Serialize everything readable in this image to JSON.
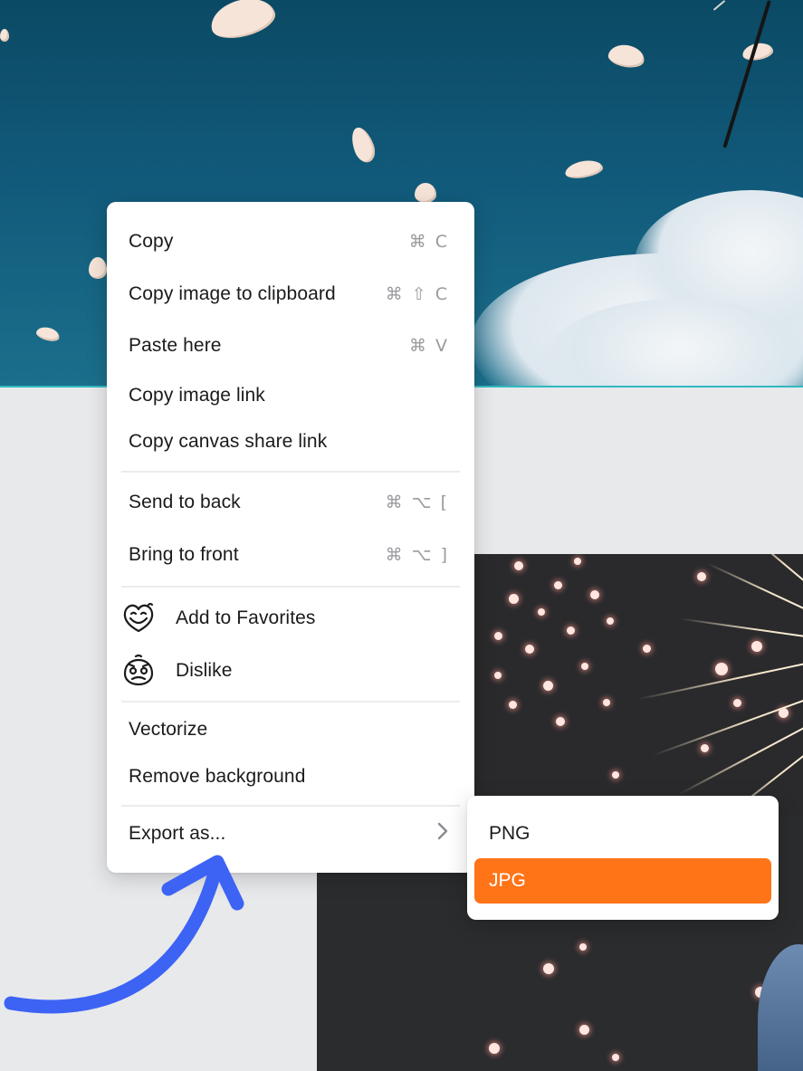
{
  "context_menu": {
    "items": [
      {
        "label": "Copy",
        "shortcut": "⌘ C"
      },
      {
        "label": "Copy image to clipboard",
        "shortcut": "⌘ ⇧ C"
      },
      {
        "label": "Paste here",
        "shortcut": "⌘ V"
      },
      {
        "label": "Copy image link",
        "shortcut": ""
      },
      {
        "label": "Copy canvas share link",
        "shortcut": ""
      },
      {
        "label": "Send to back",
        "shortcut": "⌘ ⌥ ["
      },
      {
        "label": "Bring to front",
        "shortcut": "⌘ ⌥ ]"
      },
      {
        "label": "Add to Favorites",
        "icon": "smiling-face-icon"
      },
      {
        "label": "Dislike",
        "icon": "worried-face-icon"
      },
      {
        "label": "Vectorize",
        "shortcut": ""
      },
      {
        "label": "Remove background",
        "shortcut": ""
      },
      {
        "label": "Export as...",
        "icon": "chevron-right-icon"
      }
    ]
  },
  "export_submenu": {
    "options": [
      {
        "label": "PNG",
        "selected": false
      },
      {
        "label": "JPG",
        "selected": true
      }
    ],
    "accent_color": "#ff7417"
  },
  "annotation": {
    "arrow_color": "#3d63f5"
  },
  "background": {
    "sky_color": "#11597a",
    "canvas_color": "#e8e9eb",
    "photo_color": "#2b2c2e"
  }
}
